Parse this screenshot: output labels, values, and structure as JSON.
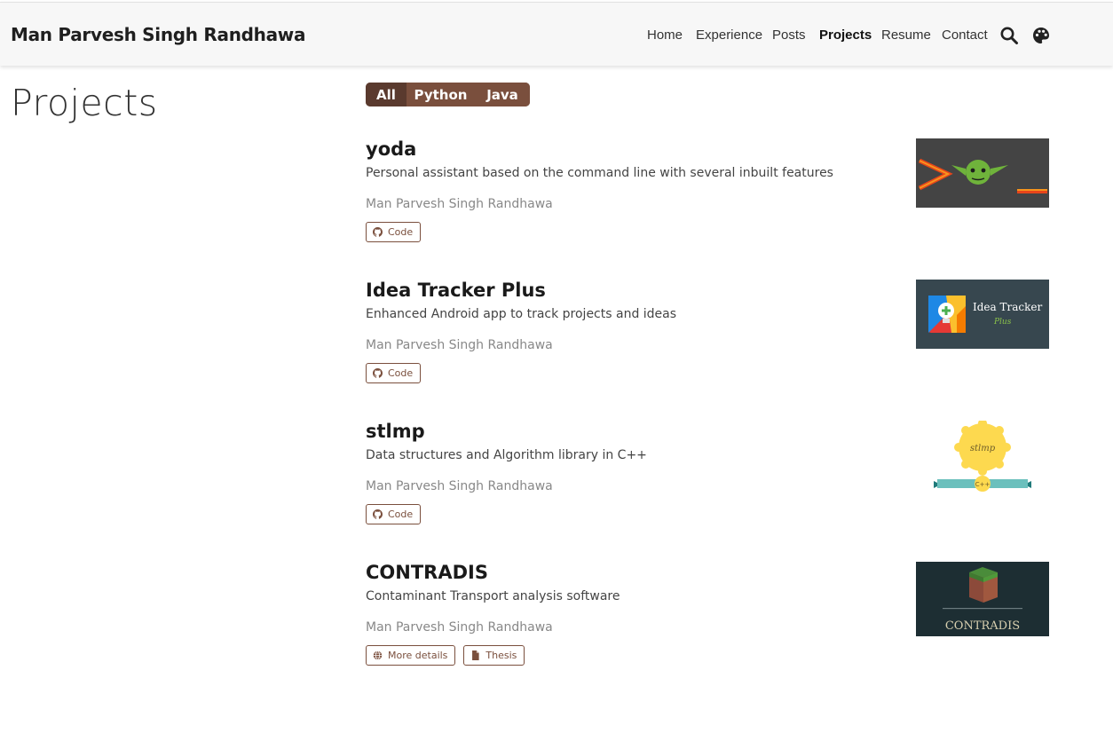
{
  "site": {
    "title": "Man Parvesh Singh Randhawa"
  },
  "nav": {
    "links": [
      "Home",
      "Experience",
      "Posts",
      "Projects",
      "Resume",
      "Contact"
    ],
    "active": "Projects",
    "icons": [
      "search-icon",
      "palette-icon"
    ]
  },
  "page": {
    "title": "Projects"
  },
  "filters": {
    "items": [
      "All",
      "Python",
      "Java"
    ],
    "active": "All"
  },
  "projects": [
    {
      "title": "yoda",
      "description": "Personal assistant based on the command line with several inbuilt features",
      "author": "Man Parvesh Singh Randhawa",
      "buttons": [
        {
          "label": "Code",
          "icon": "github-icon"
        }
      ]
    },
    {
      "title": "Idea Tracker Plus",
      "description": "Enhanced Android app to track projects and ideas",
      "author": "Man Parvesh Singh Randhawa",
      "buttons": [
        {
          "label": "Code",
          "icon": "github-icon"
        }
      ],
      "thumbnail_text": [
        "Idea Tracker",
        "Plus"
      ]
    },
    {
      "title": "stlmp",
      "description": "Data structures and Algorithm library in C++",
      "author": "Man Parvesh Singh Randhawa",
      "buttons": [
        {
          "label": "Code",
          "icon": "github-icon"
        }
      ],
      "thumbnail_text": [
        "stlmp",
        "C++"
      ]
    },
    {
      "title": "CONTRADIS",
      "description": "Contaminant Transport analysis software",
      "author": "Man Parvesh Singh Randhawa",
      "buttons": [
        {
          "label": "More details",
          "icon": "globe-icon"
        },
        {
          "label": "Thesis",
          "icon": "file-icon"
        }
      ],
      "thumbnail_text": [
        "CONTRADIS"
      ]
    }
  ],
  "colors": {
    "accent": "#7a4f3d",
    "accent_dark": "#5a3a2e",
    "navbar_bg": "#f7f7f7"
  }
}
